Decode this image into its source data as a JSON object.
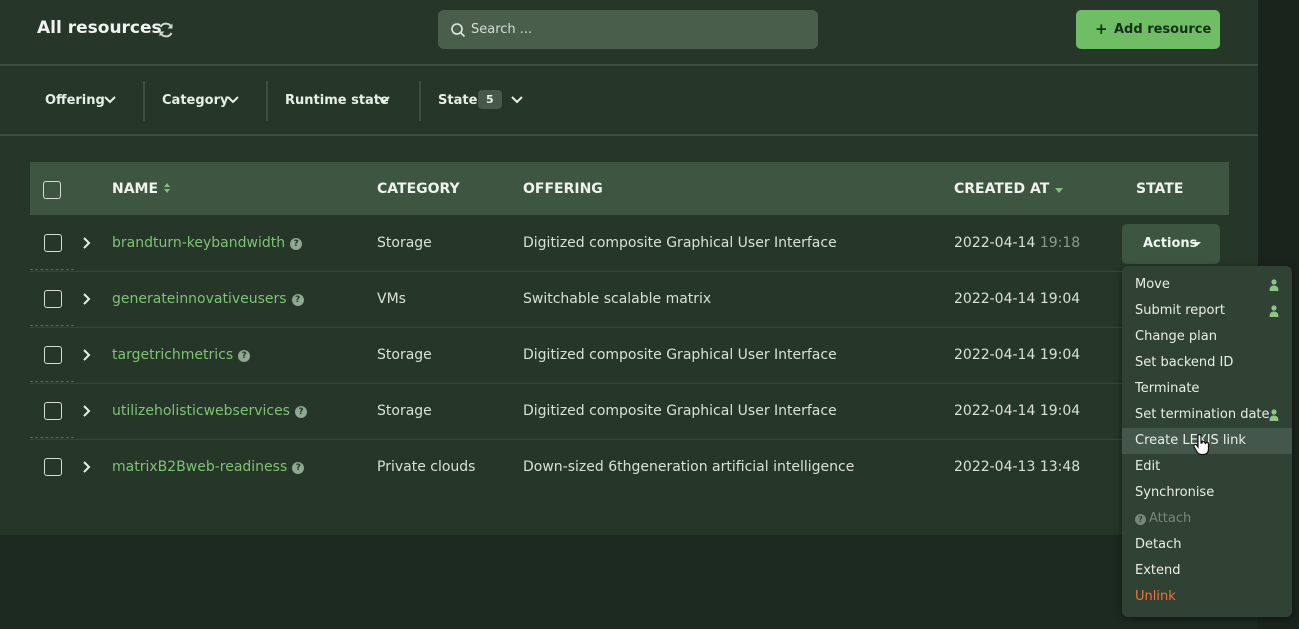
{
  "header": {
    "title": "All resources",
    "search_placeholder": "Search ...",
    "add_label": "Add resource"
  },
  "filters": [
    {
      "label": "Offering"
    },
    {
      "label": "Category"
    },
    {
      "label": "Runtime state"
    },
    {
      "label": "State",
      "count": "5"
    }
  ],
  "table": {
    "columns": [
      "NAME",
      "CATEGORY",
      "OFFERING",
      "CREATED AT",
      "STATE"
    ],
    "rows": [
      {
        "name": "brandturn-keybandwidth",
        "category": "Storage",
        "offering": "Digitized composite Graphical User Interface",
        "date": "2022-04-14",
        "time": "19:18"
      },
      {
        "name": "generateinnovativeusers",
        "category": "VMs",
        "offering": "Switchable scalable matrix",
        "date": "2022-04-14",
        "time": "19:04"
      },
      {
        "name": "targetrichmetrics",
        "category": "Storage",
        "offering": "Digitized composite Graphical User Interface",
        "date": "2022-04-14",
        "time": "19:04"
      },
      {
        "name": "utilizeholisticwebservices",
        "category": "Storage",
        "offering": "Digitized composite Graphical User Interface",
        "date": "2022-04-14",
        "time": "19:04"
      },
      {
        "name": "matrixB2Bweb-readiness",
        "category": "Private clouds",
        "offering": "Down-sized 6thgeneration artificial intelligence",
        "date": "2022-04-13",
        "time": "13:48"
      }
    ]
  },
  "actions": {
    "button_label": "Actions",
    "menu": [
      {
        "label": "Move",
        "icon": "person-icon"
      },
      {
        "label": "Submit report",
        "icon": "person-icon"
      },
      {
        "label": "Change plan"
      },
      {
        "label": "Set backend ID"
      },
      {
        "label": "Terminate"
      },
      {
        "label": "Set termination date",
        "icon": "person-icon"
      },
      {
        "label": "Create LEXIS link",
        "state": "hover"
      },
      {
        "label": "Edit"
      },
      {
        "label": "Synchronise"
      },
      {
        "label": "Attach",
        "state": "disabled"
      },
      {
        "label": "Detach"
      },
      {
        "label": "Extend"
      },
      {
        "label": "Unlink",
        "state": "danger"
      }
    ]
  },
  "colors": {
    "background": "#1d2a20",
    "panel": "#263628",
    "accent_green": "#6fbd64",
    "link_green": "#7ec474",
    "danger": "#e8763f"
  }
}
